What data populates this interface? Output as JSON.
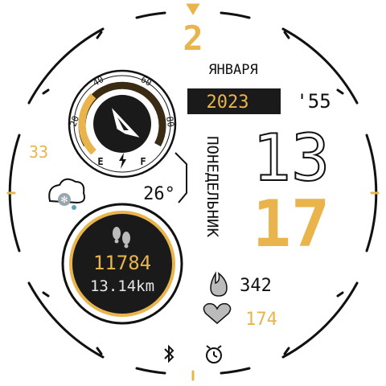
{
  "date": {
    "day": "2",
    "month": "ЯНВАРЯ",
    "year": "2023",
    "weekday": "ПОНЕДЕЛЬНИК"
  },
  "time": {
    "hours": "13",
    "minutes": "17",
    "seconds": "'55"
  },
  "battery": {
    "percent": "33",
    "gauge_ticks": [
      "20",
      "40",
      "60",
      "80"
    ],
    "empty_label": "E",
    "full_label": "F",
    "level": 0.33
  },
  "weather": {
    "temperature": "26°",
    "icon": "cloud-snow-icon"
  },
  "steps": {
    "count": "11784",
    "distance": "13.14km",
    "icon": "footprints-icon"
  },
  "calories": {
    "value": "342",
    "icon": "flame-icon"
  },
  "heart_rate": {
    "value": "174",
    "icon": "heart-icon"
  },
  "status": {
    "bluetooth_icon": "bluetooth-icon",
    "alarm_icon": "alarm-clock-icon"
  },
  "colors": {
    "accent": "#E9B44C",
    "dark": "#1a1a1a",
    "outline": "#222222",
    "muted": "#8a8a8a"
  }
}
